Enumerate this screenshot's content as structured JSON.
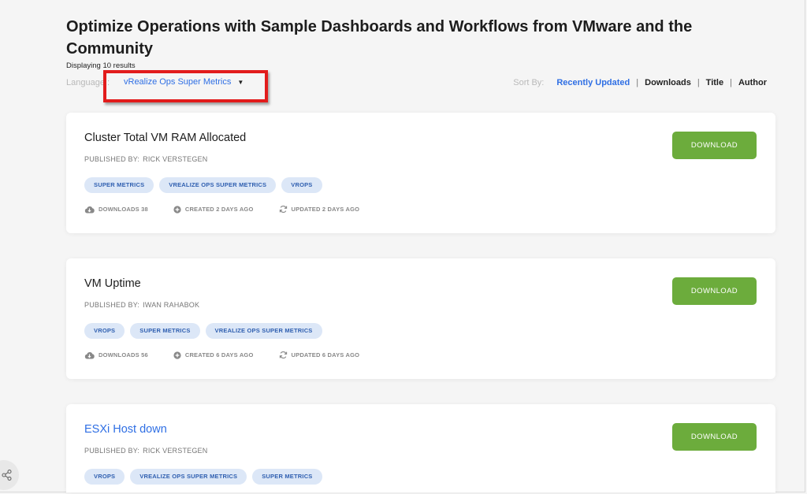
{
  "header": {
    "title": "Optimize Operations with Sample Dashboards and Workflows from VMware and the Community",
    "result_count": "Displaying 10 results",
    "language_label": "Language :",
    "language_value": "vRealize Ops Super Metrics"
  },
  "sort": {
    "label": "Sort By:",
    "options": [
      "Recently Updated",
      "Downloads",
      "Title",
      "Author"
    ],
    "active": "Recently Updated",
    "separator": "|"
  },
  "cards": [
    {
      "title": "Cluster Total VM RAM Allocated",
      "publisher_label": "PUBLISHED BY:",
      "publisher": "RICK VERSTEGEN",
      "tags": [
        "SUPER METRICS",
        "VREALIZE OPS SUPER METRICS",
        "VROPS"
      ],
      "downloads": "DOWNLOADS 38",
      "created": "CREATED 2 DAYS AGO",
      "updated": "UPDATED 2 DAYS AGO",
      "button": "DOWNLOAD"
    },
    {
      "title": "VM Uptime",
      "publisher_label": "PUBLISHED BY:",
      "publisher": "IWAN RAHABOK",
      "tags": [
        "VROPS",
        "SUPER METRICS",
        "VREALIZE OPS SUPER METRICS"
      ],
      "downloads": "DOWNLOADS 56",
      "created": "CREATED 6 DAYS AGO",
      "updated": "UPDATED 6 DAYS AGO",
      "button": "DOWNLOAD"
    },
    {
      "title": "ESXi Host down",
      "publisher_label": "PUBLISHED BY:",
      "publisher": "RICK VERSTEGEN",
      "tags": [
        "VROPS",
        "VREALIZE OPS SUPER METRICS",
        "SUPER METRICS"
      ],
      "button": "DOWNLOAD"
    }
  ],
  "colors": {
    "accent": "#2f6fe4",
    "download_button": "#6cac3c",
    "highlight": "#e21c1c",
    "tag_bg": "#dce7f7"
  },
  "icons": [
    "caret-down-icon",
    "cloud-download-icon",
    "plus-circle-icon",
    "refresh-icon",
    "share-icon"
  ]
}
